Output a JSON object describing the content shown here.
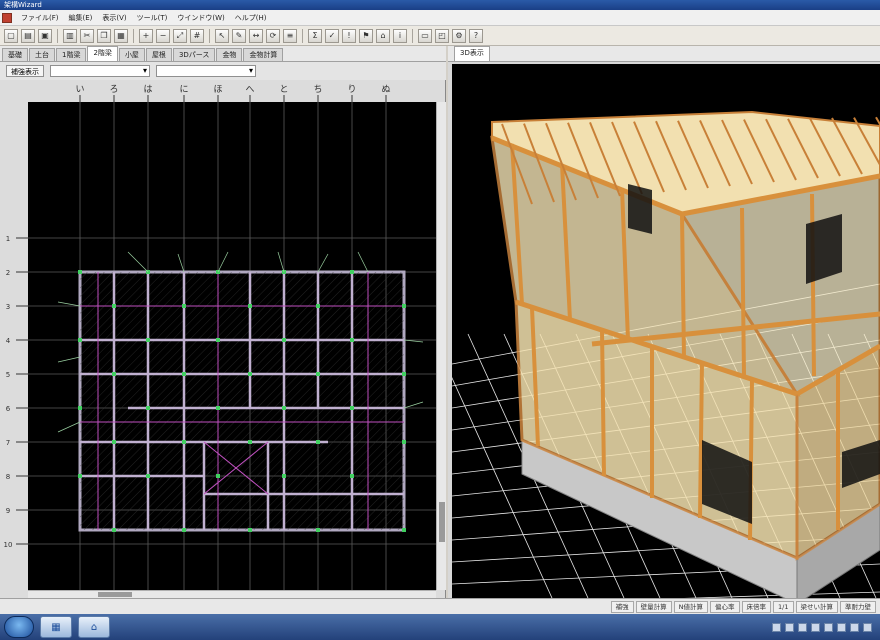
{
  "window": {
    "title": "架構Wizard"
  },
  "menu": [
    "ファイル(F)",
    "編集(E)",
    "表示(V)",
    "ツール(T)",
    "ウインドウ(W)",
    "ヘルプ(H)"
  ],
  "left_tabs": [
    "基礎",
    "土台",
    "1階梁",
    "2階梁",
    "小屋",
    "屋根",
    "3Dパース",
    "金物",
    "金物計算"
  ],
  "left_active_tab": "2階梁",
  "subbar": {
    "button": "補強表示",
    "combo1": "",
    "combo2": ""
  },
  "grid": {
    "col_labels": [
      "い",
      "ろ",
      "は",
      "に",
      "ほ",
      "へ",
      "と",
      "ち",
      "り",
      "ぬ"
    ],
    "row_labels": [
      "1",
      "2",
      "3",
      "4",
      "5",
      "6",
      "7",
      "8",
      "9",
      "10"
    ]
  },
  "right_tab": "3D表示",
  "status": [
    "補強",
    "壁量計算",
    "N値計算",
    "偏心率",
    "床倍率",
    "1/1",
    "梁せい計算",
    "準耐力壁"
  ],
  "colors": {
    "bg_plan": "#000000",
    "grid": "#6a6a6a",
    "beam": "#d8a060",
    "panel": "#f8e8b0",
    "foundation": "#c0c0c0"
  }
}
